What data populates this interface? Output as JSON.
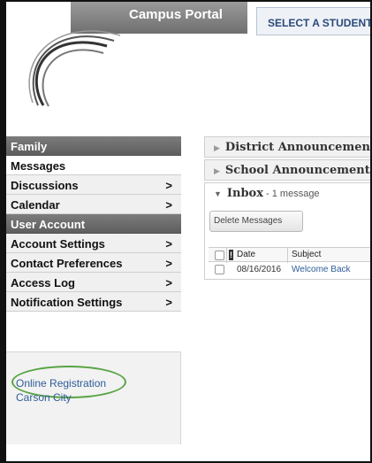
{
  "header": {
    "portal_tab": "Campus Portal",
    "student_tab": "SELECT A STUDENT"
  },
  "sidebar": {
    "family_header": "Family",
    "family_items": [
      {
        "label": "Messages",
        "arrow": ""
      },
      {
        "label": "Discussions",
        "arrow": ">"
      },
      {
        "label": "Calendar",
        "arrow": ">"
      }
    ],
    "account_header": "User Account",
    "account_items": [
      {
        "label": "Account Settings",
        "arrow": ">"
      },
      {
        "label": "Contact Preferences",
        "arrow": ">"
      },
      {
        "label": "Access Log",
        "arrow": ">"
      },
      {
        "label": "Notification Settings",
        "arrow": ">"
      }
    ],
    "links": {
      "online_registration": "Online Registration",
      "carson_city": "Carson City"
    }
  },
  "content": {
    "district_announcements": "District Announcements",
    "school_announcements": "School Announcements",
    "inbox": {
      "title": "Inbox",
      "count": " - 1 message",
      "delete_button": "Delete Messages",
      "columns": {
        "flag": "!",
        "date": "Date",
        "subject": "Subject"
      },
      "rows": [
        {
          "date": "08/16/2016",
          "subject": "Welcome Back"
        }
      ]
    }
  },
  "colors": {
    "highlight": "#58a444",
    "link": "#2e5d99",
    "header_gray": "#6f6f6f"
  }
}
